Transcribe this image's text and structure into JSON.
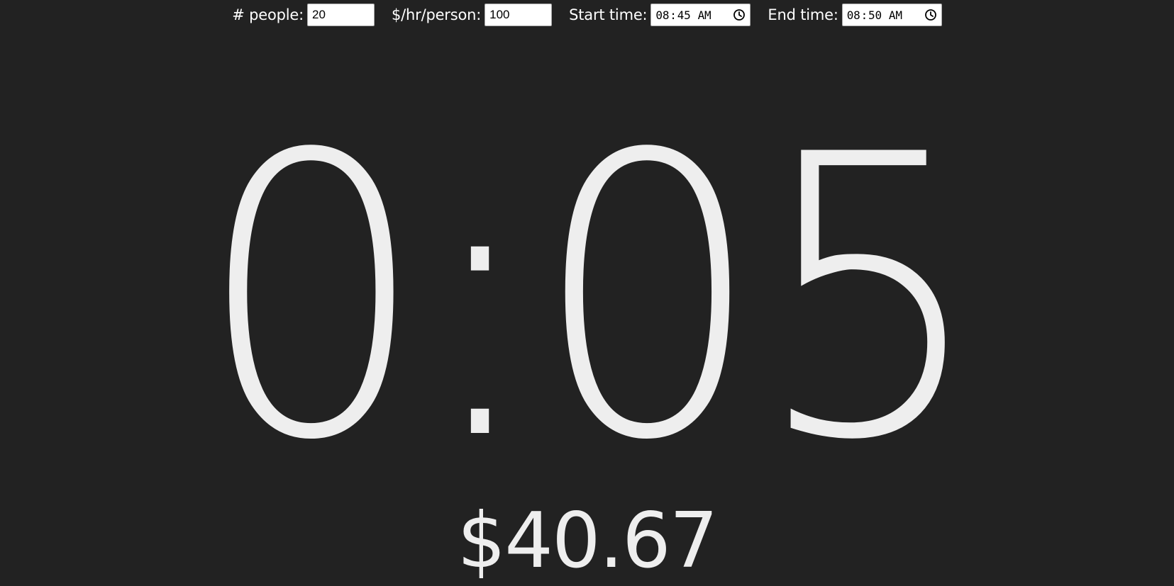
{
  "controls": {
    "people": {
      "label": "# people:",
      "value": "20"
    },
    "rate": {
      "label": "$/hr/person:",
      "value": "100"
    },
    "start": {
      "label": "Start time:",
      "hh": "08",
      "mm": "45",
      "ampm": "AM"
    },
    "end": {
      "label": "End time:",
      "hh": "08",
      "mm": "50",
      "ampm": "AM"
    }
  },
  "display": {
    "elapsed": "0:05",
    "cost": "$40.67"
  },
  "colors": {
    "background": "#222222",
    "foreground": "#eeeeee"
  },
  "icons": {
    "time_picker": "clock-icon"
  }
}
